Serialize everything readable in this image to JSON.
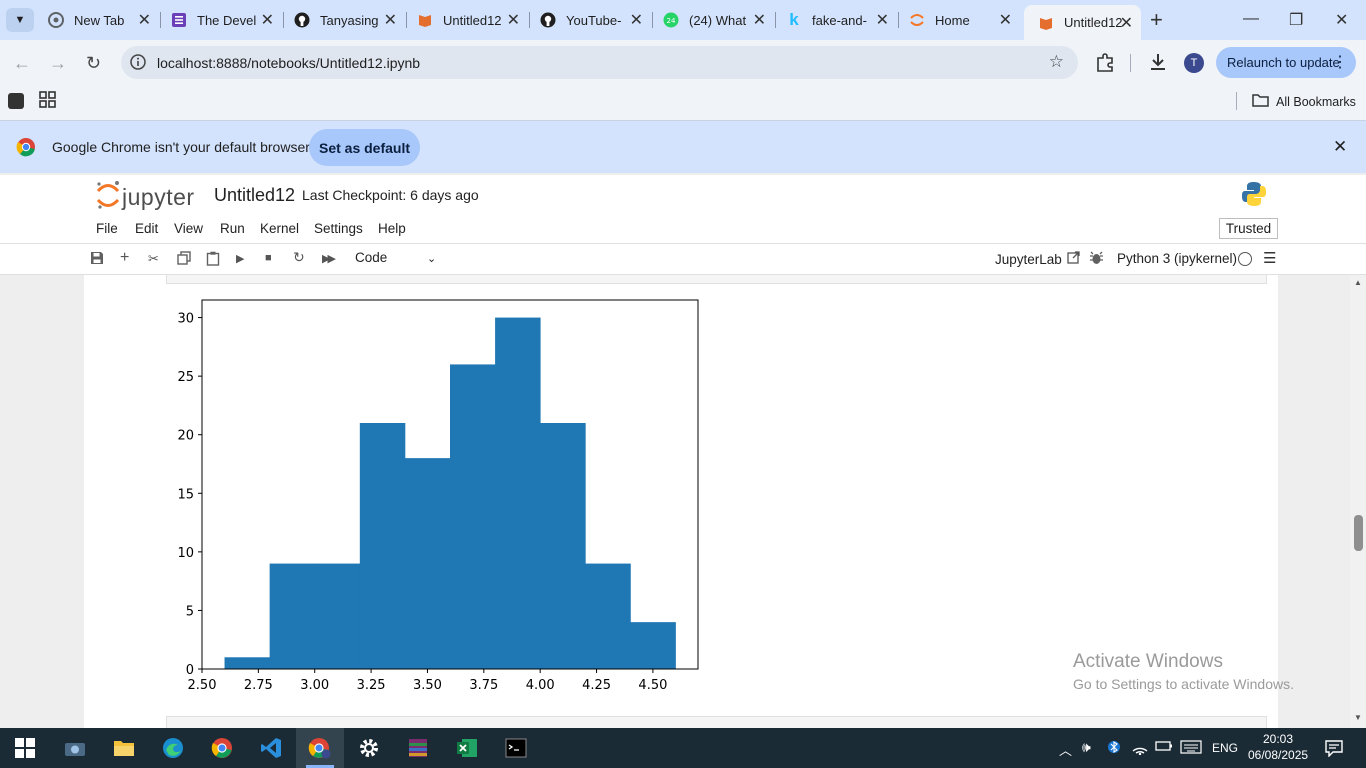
{
  "browser": {
    "tabs": [
      {
        "title": "New Tab",
        "icon": "chrome-icon",
        "color": "#5f6368"
      },
      {
        "title": "The Devel",
        "icon": "notion-icon",
        "color": "#6b3fb8"
      },
      {
        "title": "Tanyasing",
        "icon": "github-icon",
        "color": "#1f1f1f"
      },
      {
        "title": "Untitled12",
        "icon": "jupyter-book-icon",
        "color": "#e46e2e"
      },
      {
        "title": "YouTube-",
        "icon": "github-icon",
        "color": "#1f1f1f"
      },
      {
        "title": "(24) What",
        "icon": "whatsapp-icon",
        "color": "#25d366"
      },
      {
        "title": "fake-and-",
        "icon": "kaggle-icon",
        "color": "#20beff"
      },
      {
        "title": "Home",
        "icon": "jupyter-icon",
        "color": "#f37726"
      },
      {
        "title": "Untitled12",
        "icon": "jupyter-book-icon",
        "color": "#e46e2e",
        "active": true
      }
    ],
    "url": "localhost:8888/notebooks/Untitled12.ipynb",
    "relaunch_label": "Relaunch to update",
    "profile_initial": "T",
    "all_bookmarks": "All Bookmarks",
    "infobar_text": "Google Chrome isn't your default browser",
    "set_default": "Set as default"
  },
  "jupyter": {
    "logo_text": "jupyter",
    "notebook_name": "Untitled12",
    "checkpoint": "Last Checkpoint: 6 days ago",
    "menu": [
      "File",
      "Edit",
      "View",
      "Run",
      "Kernel",
      "Settings",
      "Help"
    ],
    "trusted": "Trusted",
    "cell_type": "Code",
    "jupyterlab_link": "JupyterLab",
    "kernel": "Python 3 (ipykernel)"
  },
  "chart_data": {
    "type": "bar",
    "title": "",
    "xlabel": "",
    "ylabel": "",
    "bin_edges": [
      2.6,
      2.8,
      3.0,
      3.2,
      3.4,
      3.6,
      3.8,
      4.0,
      4.2,
      4.4,
      4.6
    ],
    "values": [
      1,
      9,
      9,
      21,
      18,
      26,
      30,
      21,
      9,
      4
    ],
    "xlim": [
      2.5,
      4.7
    ],
    "ylim": [
      0,
      31.5
    ],
    "xticks": [
      "2.50",
      "2.75",
      "3.00",
      "3.25",
      "3.50",
      "3.75",
      "4.00",
      "4.25",
      "4.50"
    ],
    "yticks": [
      "0",
      "5",
      "10",
      "15",
      "20",
      "25",
      "30"
    ],
    "bar_color": "#1f77b4",
    "grid": false
  },
  "watermark": {
    "line1": "Activate Windows",
    "line2": "Go to Settings to activate Windows."
  },
  "taskbar": {
    "lang": "ENG",
    "time": "20:03",
    "date": "06/08/2025"
  }
}
